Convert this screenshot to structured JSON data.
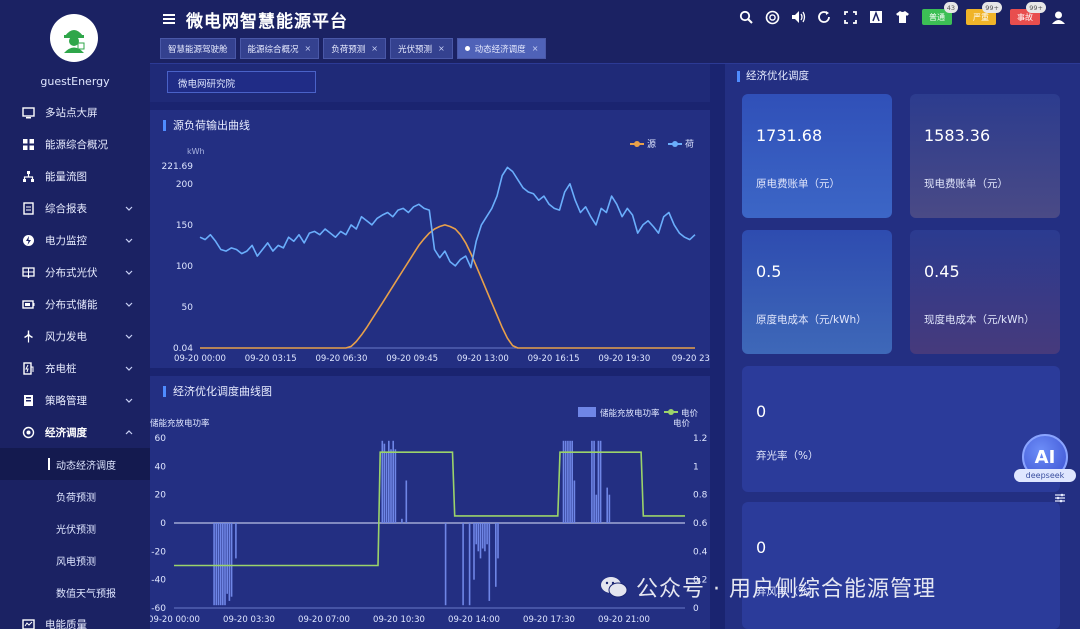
{
  "app": {
    "title": "微电网智慧能源平台"
  },
  "user": {
    "name": "guestEnergy"
  },
  "sidebar": {
    "items": [
      {
        "label": "多站点大屏",
        "icon": "monitor-icon"
      },
      {
        "label": "能源综合概况",
        "icon": "grid-icon"
      },
      {
        "label": "能量流图",
        "icon": "flow-icon"
      },
      {
        "label": "综合报表",
        "icon": "report-icon",
        "has_children": true
      },
      {
        "label": "电力监控",
        "icon": "power-icon",
        "has_children": true
      },
      {
        "label": "分布式光伏",
        "icon": "solar-icon",
        "has_children": true
      },
      {
        "label": "分布式储能",
        "icon": "battery-icon",
        "has_children": true
      },
      {
        "label": "风力发电",
        "icon": "wind-icon",
        "has_children": true
      },
      {
        "label": "充电桩",
        "icon": "charger-icon",
        "has_children": true
      },
      {
        "label": "策略管理",
        "icon": "strategy-icon",
        "has_children": true
      },
      {
        "label": "经济调度",
        "icon": "dispatch-icon",
        "has_children": true,
        "open": true
      }
    ],
    "sub_items": [
      {
        "label": "动态经济调度",
        "active": true
      },
      {
        "label": "负荷预测"
      },
      {
        "label": "光伏预测"
      },
      {
        "label": "风电预测"
      },
      {
        "label": "数值天气预报"
      }
    ],
    "last_item": {
      "label": "电能质量",
      "icon": "quality-icon"
    }
  },
  "tabs": [
    {
      "label": "智慧能源驾驶舱",
      "closable": false
    },
    {
      "label": "能源综合概况",
      "closable": true
    },
    {
      "label": "负荷预测",
      "closable": true
    },
    {
      "label": "光伏预测",
      "closable": true
    },
    {
      "label": "动态经济调度",
      "closable": true,
      "active": true
    }
  ],
  "alarms": [
    {
      "label": "普通",
      "count": "43",
      "color": "#3cbf55"
    },
    {
      "label": "严重",
      "count": "99+",
      "color": "#f0b429"
    },
    {
      "label": "事故",
      "count": "99+",
      "color": "#e84e4e"
    }
  ],
  "station": {
    "value": "微电网研究院"
  },
  "panel1": {
    "title": "源负荷输出曲线",
    "unit": "kWh",
    "legend": [
      "源",
      "荷"
    ],
    "y_ticks": [
      "221.69",
      "200",
      "150",
      "100",
      "50",
      "0.04"
    ],
    "x_ticks": [
      "09-20 00:00",
      "09-20 03:15",
      "09-20 06:30",
      "09-20 09:45",
      "09-20 13:00",
      "09-20 16:15",
      "09-20 19:30",
      "09-20 23:4"
    ]
  },
  "panel2": {
    "title": "经济优化调度曲线图",
    "left_label": "储能充放电功率",
    "right_label": "电价",
    "legend": [
      "储能充放电功率",
      "电价"
    ],
    "y_left_ticks": [
      "60",
      "40",
      "20",
      "0",
      "-20",
      "-40",
      "-60"
    ],
    "y_right_ticks": [
      "1.2",
      "1",
      "0.8",
      "0.6",
      "0.4",
      "0.2",
      "0"
    ],
    "x_ticks": [
      "09-20 00:00",
      "09-20 03:30",
      "09-20 07:00",
      "09-20 10:30",
      "09-20 14:00",
      "09-20 17:30",
      "09-20 21:00"
    ]
  },
  "right_panel": {
    "title": "经济优化调度",
    "cards": [
      {
        "value": "1731.68",
        "label": "原电费账单（元）"
      },
      {
        "value": "1583.36",
        "label": "现电费账单（元）"
      },
      {
        "value": "0.5",
        "label": "原度电成本（元/kWh）"
      },
      {
        "value": "0.45",
        "label": "现度电成本（元/kWh）"
      },
      {
        "value": "0",
        "label": "弃光率（%）"
      },
      {
        "value": "0",
        "label": "弃风率（%）"
      }
    ]
  },
  "ai": {
    "label": "AI",
    "sub": "deepseek"
  },
  "watermark": {
    "text": "公众号 · 用户侧综合能源管理"
  },
  "chart_data": [
    {
      "type": "line",
      "title": "源负荷输出曲线",
      "ylabel": "kWh",
      "ylim": [
        0.04,
        221.69
      ],
      "x_ticks": [
        "09-20 00:00",
        "09-20 03:15",
        "09-20 06:30",
        "09-20 09:45",
        "09-20 13:00",
        "09-20 16:15",
        "09-20 19:30",
        "09-20 23:4"
      ],
      "series": [
        {
          "name": "源",
          "color": "#e8a04a",
          "values": [
            0,
            0,
            0,
            0,
            0,
            0,
            0,
            0,
            0,
            0,
            0,
            0,
            0,
            0,
            0,
            0,
            0,
            0,
            0,
            0,
            0,
            0,
            0,
            0,
            0,
            0,
            0,
            0,
            0,
            2,
            8,
            16,
            25,
            35,
            45,
            55,
            65,
            75,
            85,
            95,
            105,
            115,
            125,
            133,
            140,
            145,
            148,
            150,
            148,
            145,
            138,
            128,
            115,
            100,
            85,
            70,
            55,
            40,
            25,
            12,
            3,
            0,
            0,
            0,
            0,
            0,
            0,
            0,
            0,
            0,
            0,
            0,
            0,
            0,
            0,
            0,
            0,
            0,
            0,
            0,
            0,
            0,
            0,
            0,
            0,
            0,
            0,
            0,
            0,
            0,
            0,
            0,
            0,
            0,
            0,
            0
          ]
        },
        {
          "name": "荷",
          "color": "#6aaefc",
          "values": [
            135,
            132,
            138,
            130,
            120,
            118,
            122,
            120,
            115,
            118,
            125,
            112,
            120,
            128,
            118,
            125,
            122,
            135,
            130,
            138,
            128,
            140,
            142,
            138,
            145,
            140,
            135,
            142,
            138,
            150,
            145,
            160,
            155,
            150,
            158,
            162,
            165,
            160,
            168,
            170,
            165,
            172,
            175,
            170,
            168,
            120,
            110,
            118,
            105,
            100,
            108,
            112,
            98,
            130,
            150,
            160,
            170,
            185,
            210,
            220,
            215,
            205,
            195,
            190,
            188,
            180,
            185,
            175,
            170,
            168,
            190,
            200,
            180,
            165,
            172,
            160,
            150,
            170,
            165,
            185,
            175,
            160,
            170,
            162,
            140,
            150,
            155,
            148,
            140,
            160,
            165,
            150,
            140,
            135,
            132,
            138
          ]
        }
      ]
    },
    {
      "type": "bar",
      "title": "经济优化调度曲线图",
      "ylabel": "储能充放电功率",
      "ylim": [
        -60,
        60
      ],
      "y2label": "电价",
      "y2lim": [
        0,
        1.2
      ],
      "x_ticks": [
        "09-20 00:00",
        "09-20 03:30",
        "09-20 07:00",
        "09-20 10:30",
        "09-20 14:00",
        "09-20 17:30",
        "09-20 21:00"
      ],
      "series": [
        {
          "name": "储能充放电功率",
          "type": "bar",
          "color": "#6f86e6",
          "values": [
            0,
            0,
            0,
            0,
            0,
            0,
            0,
            0,
            0,
            0,
            0,
            0,
            0,
            0,
            0,
            0,
            0,
            0,
            -58,
            -58,
            -58,
            -58,
            -58,
            -58,
            -50,
            -55,
            -52,
            0,
            -25,
            0,
            0,
            0,
            0,
            0,
            0,
            0,
            0,
            0,
            0,
            0,
            0,
            0,
            0,
            0,
            0,
            0,
            0,
            0,
            0,
            0,
            0,
            0,
            0,
            0,
            0,
            0,
            0,
            0,
            0,
            0,
            0,
            0,
            0,
            0,
            0,
            0,
            0,
            0,
            0,
            0,
            0,
            0,
            0,
            0,
            0,
            0,
            0,
            0,
            0,
            0,
            0,
            0,
            0,
            0,
            0,
            0,
            0,
            0,
            0,
            0,
            0,
            0,
            0,
            0,
            0,
            58,
            56,
            50,
            58,
            52,
            58,
            52,
            0,
            0,
            3,
            0,
            30,
            0,
            0,
            0,
            0,
            0,
            0,
            0,
            0,
            0,
            0,
            0,
            0,
            0,
            0,
            0,
            0,
            0,
            -58,
            0,
            0,
            0,
            0,
            0,
            0,
            0,
            -58,
            0,
            0,
            -58,
            0,
            -40,
            -15,
            -20,
            -25,
            -18,
            -20,
            -15,
            -55,
            0,
            0,
            -45,
            -25,
            0,
            0,
            0,
            0,
            0,
            0,
            0,
            0,
            0,
            0,
            0,
            0,
            0,
            0,
            0,
            0,
            0,
            0,
            0,
            0,
            0,
            0,
            0,
            0,
            0,
            0,
            0,
            0,
            0,
            58,
            58,
            58,
            58,
            58,
            30,
            0,
            0,
            0,
            0,
            0,
            0,
            0,
            58,
            58,
            20,
            58,
            58,
            0,
            0,
            25,
            20,
            0,
            0,
            0,
            0,
            0,
            0,
            0,
            0,
            0,
            0,
            0,
            0,
            0,
            0,
            0,
            0,
            0,
            0,
            0,
            0,
            0,
            0,
            0,
            0,
            0,
            0,
            0,
            0,
            0,
            0,
            0,
            0,
            0,
            0
          ]
        },
        {
          "name": "电价",
          "type": "line",
          "color": "#9bd36a",
          "values": [
            0.3,
            0.3,
            0.3,
            0.3,
            0.3,
            0.3,
            0.3,
            0.3,
            0.3,
            0.3,
            0.3,
            0.3,
            0.3,
            0.3,
            0.3,
            0.3,
            0.3,
            0.3,
            0.3,
            0.3,
            0.3,
            0.3,
            0.3,
            0.3,
            0.3,
            0.3,
            0.3,
            0.3,
            0.3,
            0.3,
            0.3,
            0.3,
            0.3,
            0.3,
            0.3,
            0.3,
            0.3,
            0.3,
            0.3,
            0.3,
            0.3,
            0.3,
            0.3,
            0.3,
            0.3,
            0.3,
            0.3,
            0.3,
            0.3,
            0.3,
            0.3,
            0.3,
            0.3,
            0.3,
            0.3,
            0.3,
            0.3,
            0.3,
            0.3,
            0.3,
            0.3,
            0.3,
            0.3,
            0.3,
            0.3,
            0.3,
            0.3,
            0.3,
            0.3,
            0.3,
            0.3,
            0.3,
            0.3,
            0.3,
            0.3,
            0.3,
            0.3,
            0.3,
            0.3,
            0.3,
            0.3,
            0.3,
            0.3,
            0.3,
            0.3,
            0.3,
            0.3,
            0.3,
            0.3,
            0.3,
            0.3,
            0.3,
            0.3,
            0.3,
            1.1,
            1.1,
            1.1,
            1.1,
            1.1,
            1.1,
            1.1,
            1.1,
            1.1,
            1.1,
            1.1,
            1.1,
            1.1,
            1.1,
            1.1,
            1.1,
            1.1,
            1.1,
            1.1,
            1.1,
            1.1,
            1.1,
            1.1,
            1.1,
            1.1,
            1.1,
            1.1,
            1.1,
            1.1,
            1.1,
            1.1,
            1.1,
            1.1,
            1.1,
            0.65,
            0.65,
            0.65,
            0.65,
            0.65,
            0.65,
            0.65,
            0.65,
            0.65,
            0.65,
            0.65,
            0.65,
            0.65,
            0.65,
            0.65,
            0.65,
            0.65,
            0.65,
            0.65,
            0.65,
            0.65,
            0.65,
            0.65,
            0.65,
            0.65,
            0.65,
            0.65,
            0.65,
            0.65,
            0.65,
            0.65,
            0.65,
            0.65,
            0.65,
            0.65,
            0.65,
            0.65,
            0.65,
            0.65,
            0.65,
            0.65,
            0.65,
            0.65,
            0.65,
            0.65,
            0.65,
            0.65,
            0.65,
            1.1,
            1.1,
            1.1,
            1.1,
            1.1,
            1.1,
            1.1,
            1.1,
            1.1,
            1.1,
            1.1,
            1.1,
            1.1,
            1.1,
            1.1,
            1.1,
            1.1,
            1.1,
            1.1,
            1.1,
            1.1,
            1.1,
            1.1,
            1.1,
            1.1,
            1.1,
            1.1,
            1.1,
            1.1,
            1.1,
            1.1,
            1.1,
            1.1,
            1.1,
            1.1,
            1.1,
            1.1,
            1.1,
            0.65,
            0.65,
            0.65,
            0.65,
            0.65,
            0.65,
            0.65,
            0.65,
            0.65,
            0.65,
            0.65,
            0.65,
            0.65,
            0.65,
            0.65,
            0.65,
            0.65,
            0.65,
            0.65,
            0.65
          ]
        }
      ]
    }
  ]
}
